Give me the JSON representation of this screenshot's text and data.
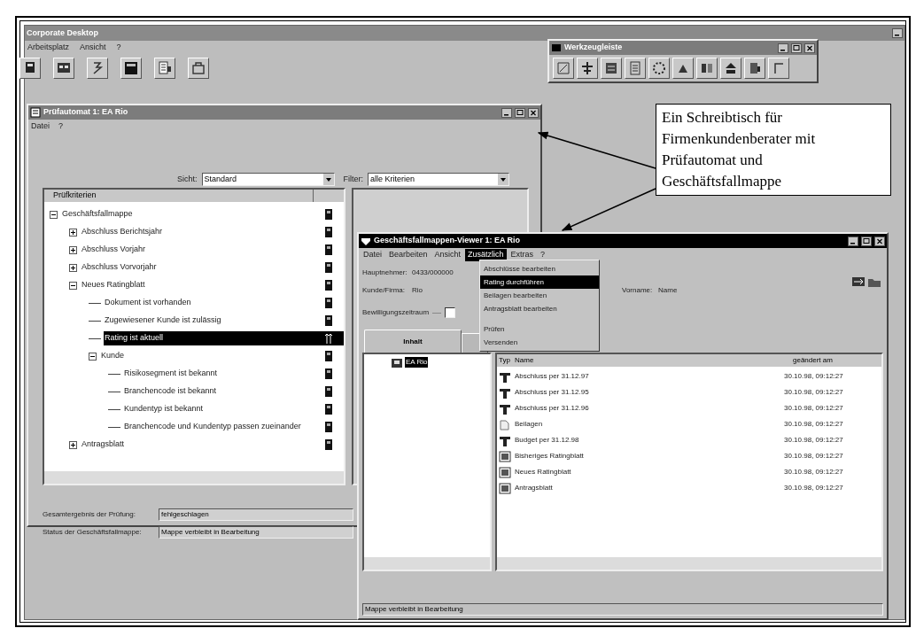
{
  "desktop": {
    "title": "Corporate Desktop",
    "menu": [
      "Arbeitsplatz",
      "Ansicht",
      "?"
    ]
  },
  "toolbox": {
    "title": "Werkzeugleiste",
    "active": false
  },
  "checker": {
    "title": "Prüfautomat 1: EA Rio",
    "active": false,
    "menu": [
      "Datei",
      "?"
    ],
    "view": {
      "label": "Sicht:",
      "value": "Standard"
    },
    "filter": {
      "label": "Filter:",
      "value": "alle Kriterien"
    },
    "tree": {
      "column": "Prüfkriterien",
      "items": [
        {
          "label": "Geschäftsfallmappe",
          "selected": false,
          "expanded": true,
          "children": [
            {
              "label": "Abschluss Berichtsjahr",
              "selected": false,
              "expanded": false
            },
            {
              "label": "Abschluss Vorjahr",
              "selected": false,
              "expanded": false
            },
            {
              "label": "Abschluss Vorvorjahr",
              "selected": false,
              "expanded": false
            },
            {
              "label": "Neues Ratingblatt",
              "selected": false,
              "expanded": true,
              "children": [
                {
                  "label": "Dokument ist vorhanden",
                  "selected": false
                },
                {
                  "label": "Zugewiesener Kunde ist zulässig",
                  "selected": false
                },
                {
                  "label": "Rating ist aktuell",
                  "selected": true
                },
                {
                  "label": "Kunde",
                  "selected": false,
                  "expanded": true,
                  "children": [
                    {
                      "label": "Risikosegment ist bekannt",
                      "selected": false
                    },
                    {
                      "label": "Branchencode ist bekannt",
                      "selected": false
                    },
                    {
                      "label": "Kundentyp ist bekannt",
                      "selected": false
                    },
                    {
                      "label": "Branchencode und Kundentyp passen zueinander",
                      "selected": false
                    }
                  ]
                }
              ]
            },
            {
              "label": "Antragsblatt",
              "selected": false,
              "expanded": false
            }
          ]
        }
      ]
    },
    "results": [
      {
        "label": "Gesamtergebnis der Prüfung:",
        "value": "fehlgeschlagen"
      },
      {
        "label": "Status der Geschäftsfallmappe:",
        "value": "Mappe verbleibt in Bearbeitung"
      }
    ]
  },
  "viewer": {
    "title": "Geschäftsfallmappen-Viewer 1: EA Rio",
    "active": true,
    "menu": [
      {
        "label": "Datei",
        "selected": false
      },
      {
        "label": "Bearbeiten",
        "selected": false
      },
      {
        "label": "Ansicht",
        "selected": false
      },
      {
        "label": "Zusätzlich",
        "selected": true
      },
      {
        "label": "Extras",
        "selected": false
      },
      {
        "label": "?",
        "selected": false
      }
    ],
    "dropdown": [
      {
        "kind": "item",
        "label": "Abschlüsse bearbeiten",
        "selected": false
      },
      {
        "kind": "item",
        "label": "Rating durchführen",
        "selected": true
      },
      {
        "kind": "item",
        "label": "Beilagen bearbeiten",
        "selected": false
      },
      {
        "kind": "item",
        "label": "Antragsblatt bearbeiten",
        "selected": false
      },
      {
        "kind": "separator"
      },
      {
        "kind": "item",
        "label": "Prüfen",
        "selected": false
      },
      {
        "kind": "item",
        "label": "Versenden",
        "selected": false
      }
    ],
    "main_holder": {
      "label": "Hauptnehmer:",
      "value": "0433/000000"
    },
    "customer": {
      "label": "Kunde/Firma:",
      "value": "Rio"
    },
    "first_name": {
      "label": "Vorname:",
      "value": "Name"
    },
    "approval": {
      "label": "Bewilligungszeitraum",
      "checked": false
    },
    "tabs": [
      {
        "label": "Inhalt",
        "selected": true
      }
    ],
    "folders": [
      {
        "label": "EA Rio",
        "selected": true
      }
    ],
    "list": {
      "columns": [
        "Typ",
        "Name",
        "geändert am"
      ],
      "rows": [
        {
          "name": "Abschluss per 31.12.97",
          "changed": "30.10.98, 09:12:27"
        },
        {
          "name": "Abschluss per 31.12.95",
          "changed": "30.10.98, 09:12:27"
        },
        {
          "name": "Abschluss per 31.12.96",
          "changed": "30.10.98, 09:12:27"
        },
        {
          "name": "Beilagen",
          "changed": "30.10.98, 09:12:27"
        },
        {
          "name": "Budget per 31.12.98",
          "changed": "30.10.98, 09:12:27"
        },
        {
          "name": "Bisheriges Ratingblatt",
          "changed": "30.10.98, 09:12:27"
        },
        {
          "name": "Neues Ratingblatt",
          "changed": "30.10.98, 09:12:27"
        },
        {
          "name": "Antragsblatt",
          "changed": "30.10.98, 09:12:27"
        }
      ]
    },
    "status": "Mappe verbleibt in Bearbeitung"
  },
  "callout": {
    "text": "Ein Schreibtisch für Firmenkundenberater mit Prüfautomat und Geschäftsfallmappe"
  }
}
